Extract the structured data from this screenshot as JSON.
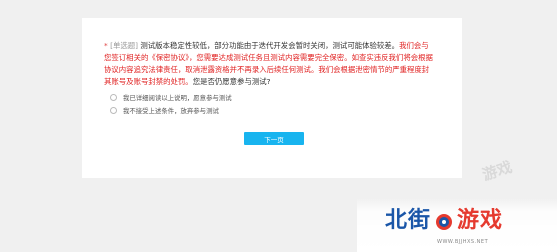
{
  "question": {
    "required_mark": "*",
    "type_label": "[单选题]",
    "text_normal_1": "测试版本稳定性较低，部分功能由于迭代开发会暂时关闭，测试可能体验较差。",
    "text_warning": "我们会与您签订相关的《保密协议》，您需要达成测试任务且测试内容需要完全保密。如查实违反我们将会根据协议内容追究法律责任，取消泄露资格并不再录入后续任何测试。我们会根据泄密情节的严重程度封其账号及账号封禁的处罚。",
    "text_normal_2": "您是否仍愿意参与测试?"
  },
  "options": [
    {
      "label": "我已详细阅读以上说明，愿意参与测试"
    },
    {
      "label": "我不接受上述条件，放弃参与测试"
    }
  ],
  "next_button_label": "下一页",
  "watermark": {
    "name_left": "北街",
    "name_right": "游戏",
    "url": "WWW.BJJHXS.NET",
    "ghost_text": "游戏"
  },
  "colors": {
    "accent": "#18b4ef",
    "warning": "#e02020",
    "watermark_blue": "#1a56a8",
    "watermark_red": "#e53a2f"
  }
}
